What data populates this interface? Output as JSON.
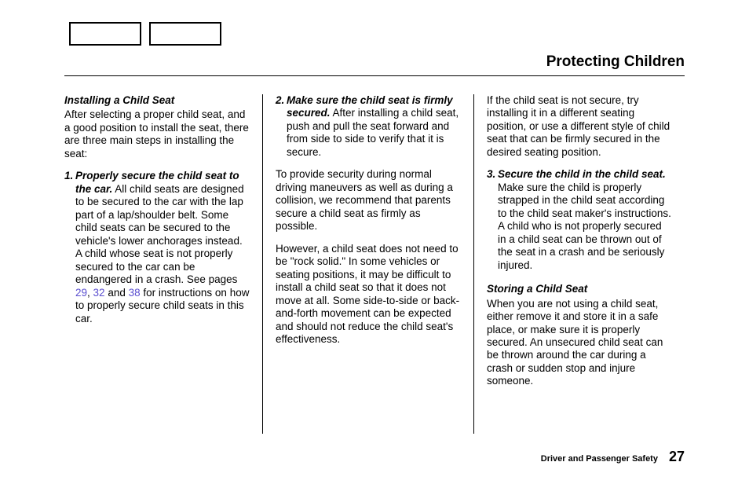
{
  "page_title": "Protecting Children",
  "col1": {
    "subhead": "Installing a  Child Seat",
    "intro": "After selecting a proper child seat, and a good position to install the seat, there are three main steps in installing the seat:",
    "step1_num": "1.",
    "step1_lead": "Properly secure the child seat to the car.",
    "step1_body_a": " All child seats are designed to be secured to the car with the lap part of a lap/shoulder belt. Some child seats can be secured to the vehicle's lower anchorages instead. A child whose seat is not properly secured to the car can be endangered in a crash. See pages ",
    "link1": "29",
    "sep1": ", ",
    "link2": "32",
    "sep2": " and ",
    "link3": "38",
    "step1_body_b": " for instructions on how to properly secure child seats in this car."
  },
  "col2": {
    "step2_num": "2.",
    "step2_lead": "Make sure the child seat is firmly secured.",
    "step2_body": " After installing a child seat, push and pull the seat forward and from side to side to verify that it is secure.",
    "p2": "To provide security during normal driving maneuvers as well as during a collision, we recommend that parents secure a child seat as firmly as possible.",
    "p3": "However, a child seat does not need to be \"rock solid.\" In some vehicles or seating positions, it may be difficult to install a child seat so that it does not move at all. Some side-to-side or back-and-forth movement can be expected and should not reduce the child seat's effectiveness."
  },
  "col3": {
    "p1": "If the child seat is not secure, try installing it in a different seating position, or use a different style of child seat that can be firmly secured in the desired seating position.",
    "step3_num": "3.",
    "step3_lead": "Secure the child in the child seat.",
    "step3_body": " Make sure the child is properly strapped in the child seat according to the child seat maker's instructions. A child who is not properly secured in a child seat can be thrown out of the seat in a crash and be seriously injured.",
    "subhead2": "Storing a  Child Seat",
    "p2": "When you are not using a child seat, either remove it and store it in a safe place, or make sure it is properly secured. An unsecured child seat can be thrown around the car during a crash or sudden stop and injure someone."
  },
  "footer": {
    "label": "Driver and Passenger Safety",
    "page": "27"
  }
}
